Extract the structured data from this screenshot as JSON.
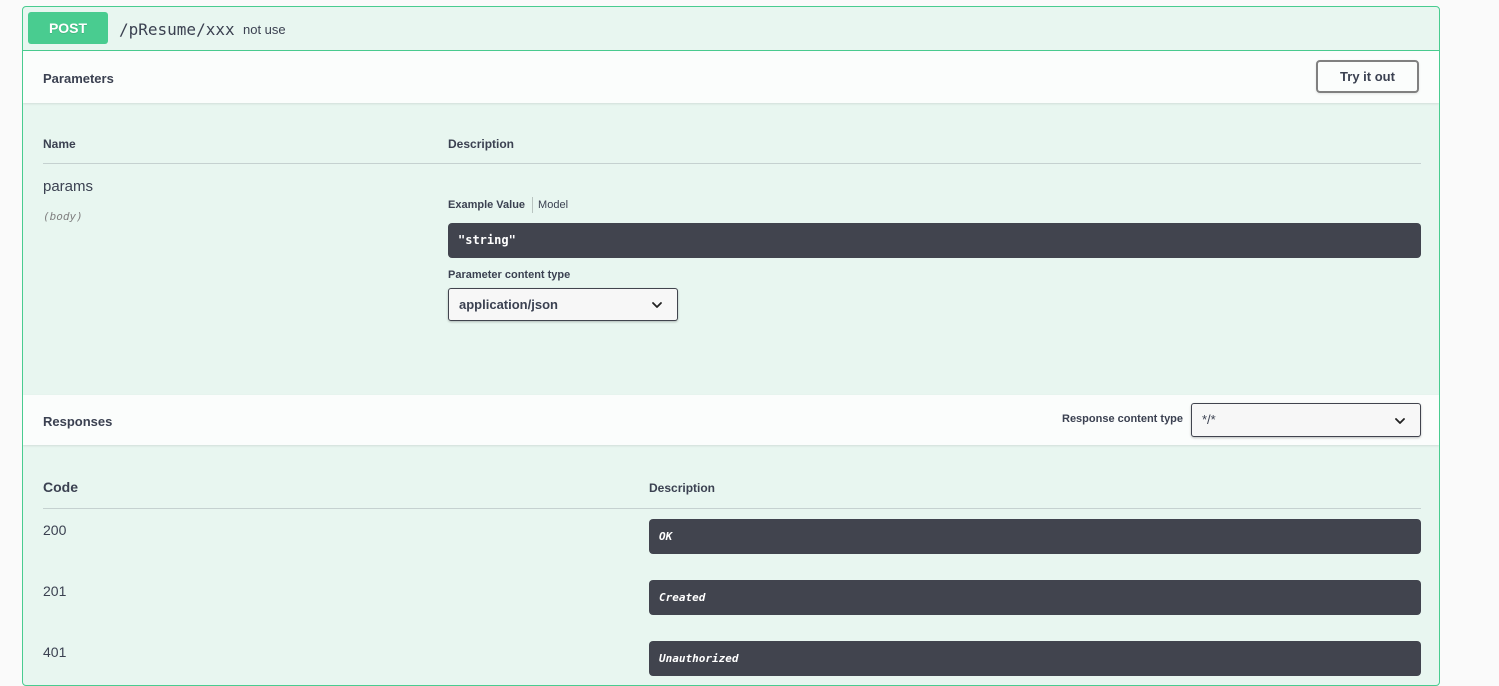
{
  "operation": {
    "method": "POST",
    "path": "/pResume/xxx",
    "summary": "not use"
  },
  "parameters": {
    "title": "Parameters",
    "try_button_label": "Try it out",
    "columns": {
      "name": "Name",
      "description": "Description"
    },
    "items": [
      {
        "name": "params",
        "location": "(body)",
        "tabs": {
          "active": "Example Value",
          "other": "Model"
        },
        "example_value": "\"string\"",
        "content_type_label": "Parameter content type",
        "content_type_selected": "application/json"
      }
    ]
  },
  "responses": {
    "title": "Responses",
    "content_type_label": "Response content type",
    "content_type_selected": "*/*",
    "columns": {
      "code": "Code",
      "description": "Description"
    },
    "items": [
      {
        "code": "200",
        "description": "OK"
      },
      {
        "code": "201",
        "description": "Created"
      },
      {
        "code": "401",
        "description": "Unauthorized"
      }
    ]
  },
  "colors": {
    "post_accent": "#49cc90",
    "block_background": "#e8f6f0",
    "code_background": "#41444e",
    "text": "#3b4151"
  },
  "icons": {
    "select_chevron": "chevron-down-icon"
  }
}
